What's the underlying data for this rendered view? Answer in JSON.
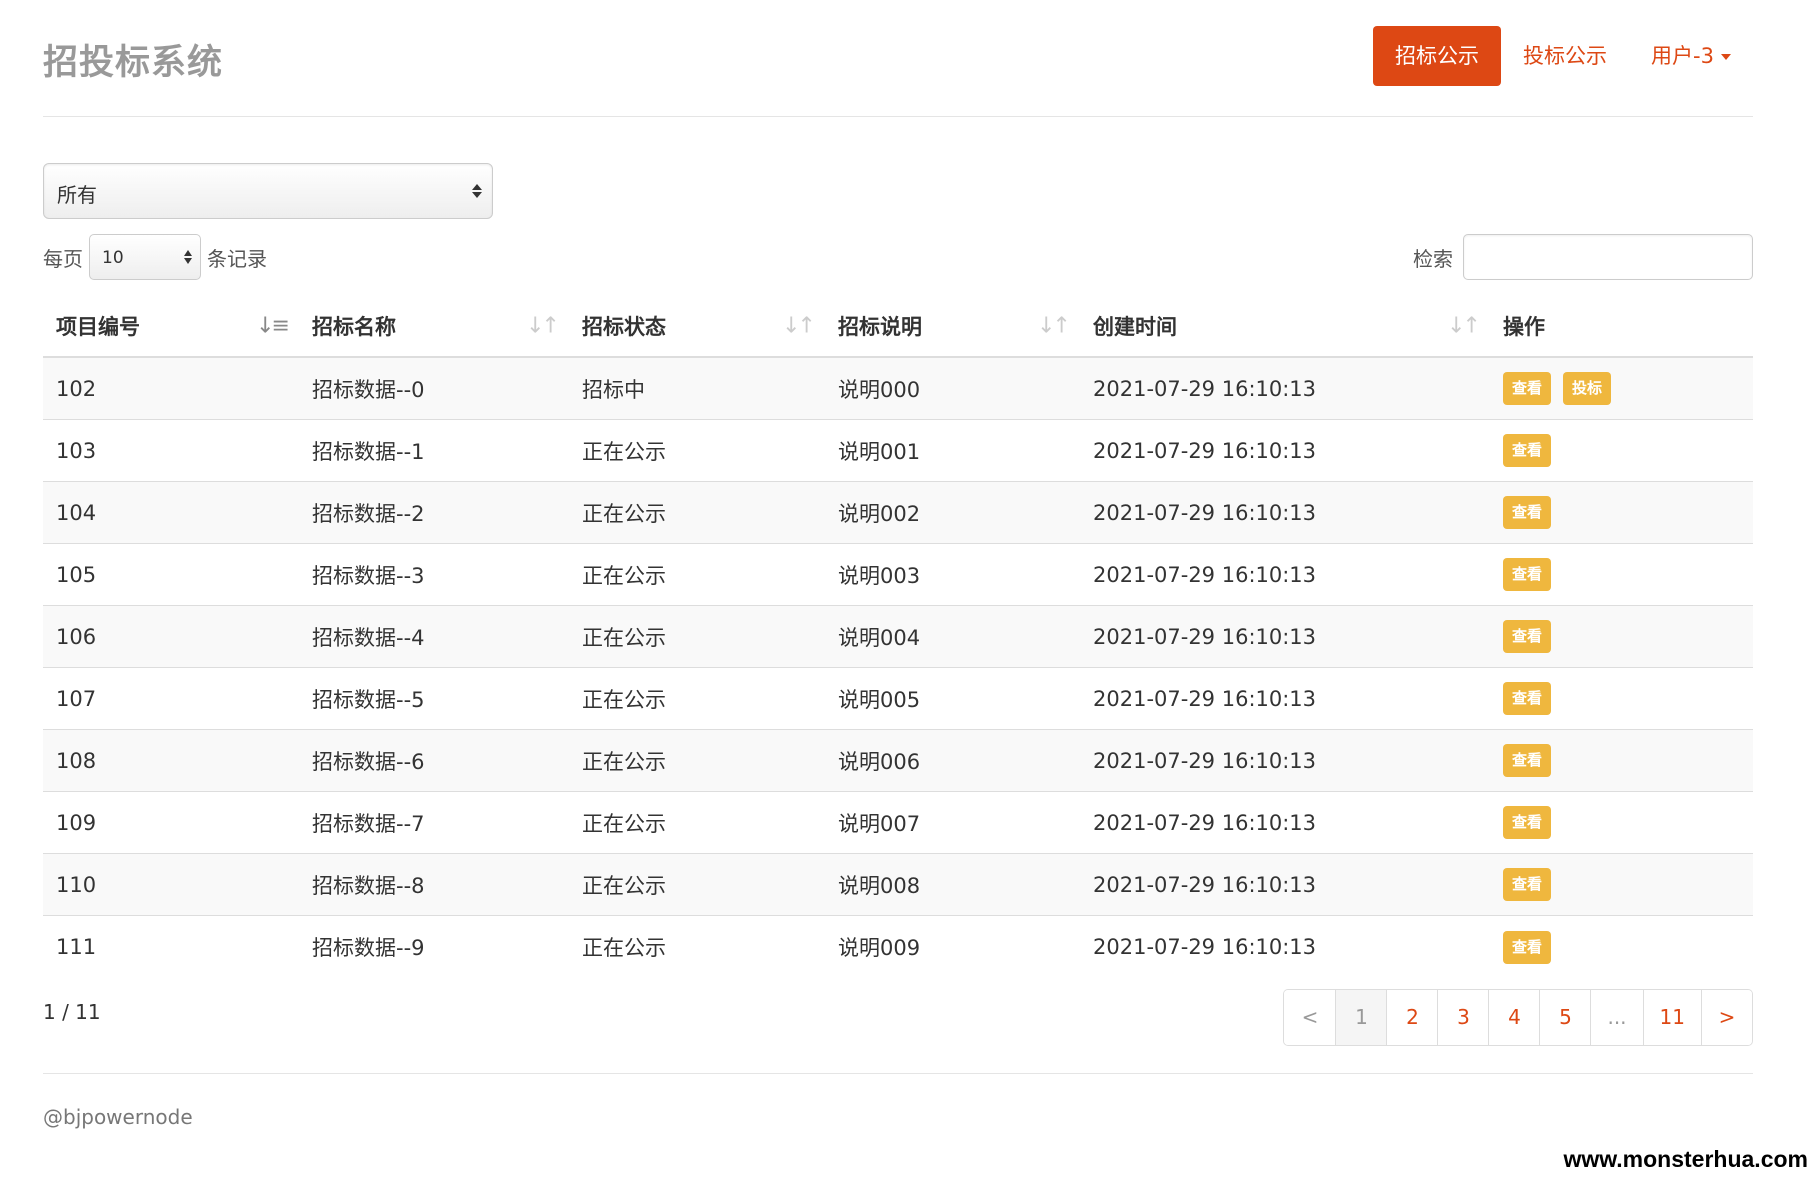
{
  "brand": "招投标系统",
  "nav": {
    "items": [
      "招标公示",
      "投标公示"
    ],
    "user_label": "用户-3"
  },
  "filter": {
    "status_selected": "所有"
  },
  "length": {
    "prefix": "每页",
    "value": "10",
    "suffix": "条记录"
  },
  "search": {
    "label": "检索",
    "value": ""
  },
  "table": {
    "columns": [
      "项目编号",
      "招标名称",
      "招标状态",
      "招标说明",
      "创建时间",
      "操作"
    ],
    "rows": [
      {
        "id": "102",
        "name": "招标数据--0",
        "status": "招标中",
        "desc": "说明000",
        "created": "2021-07-29 16:10:13",
        "actions": [
          "查看",
          "投标"
        ]
      },
      {
        "id": "103",
        "name": "招标数据--1",
        "status": "正在公示",
        "desc": "说明001",
        "created": "2021-07-29 16:10:13",
        "actions": [
          "查看"
        ]
      },
      {
        "id": "104",
        "name": "招标数据--2",
        "status": "正在公示",
        "desc": "说明002",
        "created": "2021-07-29 16:10:13",
        "actions": [
          "查看"
        ]
      },
      {
        "id": "105",
        "name": "招标数据--3",
        "status": "正在公示",
        "desc": "说明003",
        "created": "2021-07-29 16:10:13",
        "actions": [
          "查看"
        ]
      },
      {
        "id": "106",
        "name": "招标数据--4",
        "status": "正在公示",
        "desc": "说明004",
        "created": "2021-07-29 16:10:13",
        "actions": [
          "查看"
        ]
      },
      {
        "id": "107",
        "name": "招标数据--5",
        "status": "正在公示",
        "desc": "说明005",
        "created": "2021-07-29 16:10:13",
        "actions": [
          "查看"
        ]
      },
      {
        "id": "108",
        "name": "招标数据--6",
        "status": "正在公示",
        "desc": "说明006",
        "created": "2021-07-29 16:10:13",
        "actions": [
          "查看"
        ]
      },
      {
        "id": "109",
        "name": "招标数据--7",
        "status": "正在公示",
        "desc": "说明007",
        "created": "2021-07-29 16:10:13",
        "actions": [
          "查看"
        ]
      },
      {
        "id": "110",
        "name": "招标数据--8",
        "status": "正在公示",
        "desc": "说明008",
        "created": "2021-07-29 16:10:13",
        "actions": [
          "查看"
        ]
      },
      {
        "id": "111",
        "name": "招标数据--9",
        "status": "正在公示",
        "desc": "说明009",
        "created": "2021-07-29 16:10:13",
        "actions": [
          "查看"
        ]
      }
    ]
  },
  "pagination": {
    "info": "1 / 11",
    "prev": "<",
    "pages": [
      "1",
      "2",
      "3",
      "4",
      "5",
      "...",
      "11"
    ],
    "current": "1",
    "next": ">"
  },
  "footer": "@bjpowernode",
  "watermark": "www.monsterhua.com",
  "colors": {
    "accent": "#dd4814",
    "button": "#efb73e",
    "brand_text": "#999999"
  },
  "icons": {
    "sort_active": "sort-asc-icon",
    "sort": "sort-both-icon",
    "dropdown": "caret-down-icon"
  }
}
